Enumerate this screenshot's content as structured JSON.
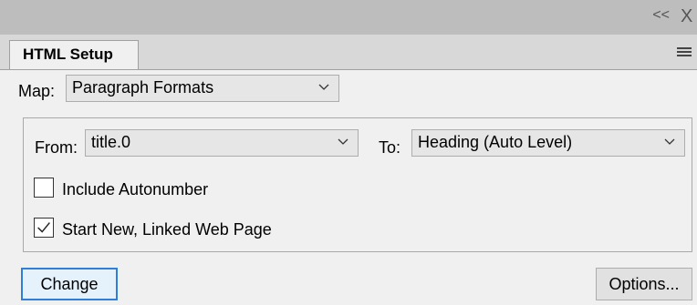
{
  "titlebar": {
    "collapse_glyph": "<<",
    "close_glyph": "X"
  },
  "tab": {
    "label": "HTML Setup"
  },
  "map": {
    "label": "Map:",
    "value": "Paragraph Formats"
  },
  "from": {
    "label": "From:",
    "value": "title.0"
  },
  "to": {
    "label": "To:",
    "value": "Heading (Auto Level)"
  },
  "options_group": {
    "include_autonumber": {
      "label": "Include Autonumber",
      "checked": false
    },
    "start_new_page": {
      "label": "Start New, Linked Web Page",
      "checked": true
    }
  },
  "buttons": {
    "change": "Change",
    "options": "Options..."
  },
  "icons": [
    "collapse-icon",
    "close-icon",
    "panel-menu-icon",
    "chevron-down-icon",
    "checkmark-icon"
  ],
  "colors": {
    "focus_border": "#2f7ed8",
    "titlebar": "#bdbdbd"
  }
}
